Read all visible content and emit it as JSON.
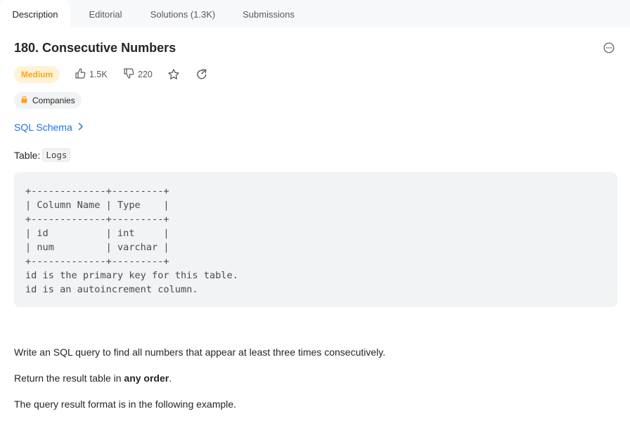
{
  "tabs": [
    {
      "label": "Description",
      "active": true
    },
    {
      "label": "Editorial",
      "active": false
    },
    {
      "label": "Solutions (1.3K)",
      "active": false
    },
    {
      "label": "Submissions",
      "active": false
    }
  ],
  "problem": {
    "title": "180. Consecutive Numbers",
    "difficulty": "Medium",
    "likes": "1.5K",
    "dislikes": "220",
    "companies_label": "Companies",
    "schema_link": "SQL Schema",
    "table_prefix": "Table: ",
    "table_name": "Logs",
    "schema_text": "+-------------+---------+\n| Column Name | Type    |\n+-------------+---------+\n| id          | int     |\n| num         | varchar |\n+-------------+---------+\nid is the primary key for this table.\nid is an autoincrement column.",
    "paragraph1": "Write an SQL query to find all numbers that appear at least three times consecutively.",
    "paragraph2_before": "Return the result table in ",
    "paragraph2_bold": "any order",
    "paragraph2_after": ".",
    "paragraph3": "The query result format is in the following example."
  },
  "colors": {
    "difficulty_medium": "#ffa116",
    "difficulty_medium_bg": "#fff3d6",
    "link": "#1a73e8",
    "code_bg": "#f2f3f5",
    "tabbar_bg": "#f7f8fa"
  },
  "icons": [
    "more-options-icon",
    "thumbs-up-icon",
    "thumbs-down-icon",
    "star-icon",
    "share-icon",
    "lock-icon",
    "chevron-right-icon"
  ]
}
